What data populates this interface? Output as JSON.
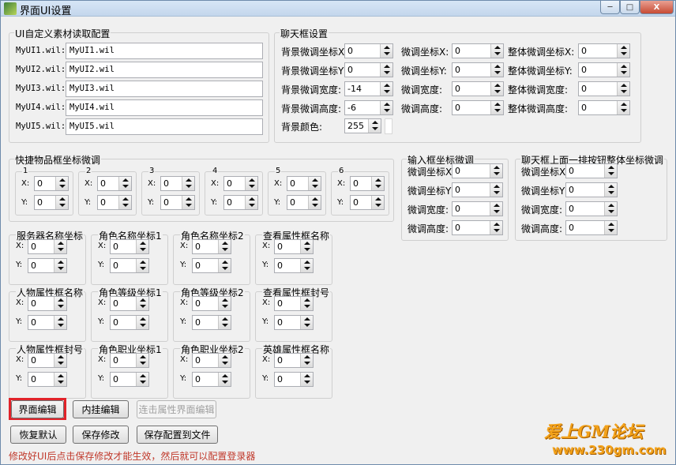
{
  "window": {
    "title": "界面UI设置",
    "controls": [
      "─",
      "□",
      "X"
    ]
  },
  "ui_group": {
    "title": "UI自定义素材读取配置",
    "rows": [
      {
        "label": "MyUI1.wil:",
        "value": "MyUI1.wil"
      },
      {
        "label": "MyUI2.wil:",
        "value": "MyUI2.wil"
      },
      {
        "label": "MyUI3.wil:",
        "value": "MyUI3.wil"
      },
      {
        "label": "MyUI4.wil:",
        "value": "MyUI4.wil"
      },
      {
        "label": "MyUI5.wil:",
        "value": "MyUI5.wil"
      }
    ]
  },
  "chat_group": {
    "title": "聊天框设置",
    "col1": [
      {
        "label": "背景微调坐标X",
        "value": "0"
      },
      {
        "label": "背景微调坐标Y",
        "value": "0"
      },
      {
        "label": "背景微调宽度:",
        "value": "-14"
      },
      {
        "label": "背景微调高度:",
        "value": "-6"
      }
    ],
    "col2": [
      {
        "label": "微调坐标X:",
        "value": "0"
      },
      {
        "label": "微调坐标Y:",
        "value": "0"
      },
      {
        "label": "微调宽度:",
        "value": "0"
      },
      {
        "label": "微调高度:",
        "value": "0"
      }
    ],
    "col3": [
      {
        "label": "整体微调坐标X:",
        "value": "0"
      },
      {
        "label": "整体微调坐标Y:",
        "value": "0"
      },
      {
        "label": "整体微调宽度:",
        "value": "0"
      },
      {
        "label": "整体微调高度:",
        "value": "0"
      }
    ],
    "bg_color_label": "背景颜色:",
    "bg_color_value": "255"
  },
  "quick_group": {
    "title": "快捷物品框坐标微调",
    "slots": [
      {
        "num": "1",
        "x": "0",
        "y": "0"
      },
      {
        "num": "2",
        "x": "0",
        "y": "0"
      },
      {
        "num": "3",
        "x": "0",
        "y": "0"
      },
      {
        "num": "4",
        "x": "0",
        "y": "0"
      },
      {
        "num": "5",
        "x": "0",
        "y": "0"
      },
      {
        "num": "6",
        "x": "0",
        "y": "0"
      }
    ],
    "x_label": "X:",
    "y_label": "Y:"
  },
  "input_group": {
    "title": "输入框坐标微调",
    "rows": [
      {
        "label": "微调坐标X",
        "value": "0"
      },
      {
        "label": "微调坐标Y",
        "value": "0"
      },
      {
        "label": "微调宽度:",
        "value": "0"
      },
      {
        "label": "微调高度:",
        "value": "0"
      }
    ]
  },
  "chatbtn_group": {
    "title": "聊天框上面一排按钮整体坐标微调",
    "rows": [
      {
        "label": "微调坐标X",
        "value": "0"
      },
      {
        "label": "微调坐标Y",
        "value": "0"
      },
      {
        "label": "微调宽度:",
        "value": "0"
      },
      {
        "label": "微调高度:",
        "value": "0"
      }
    ]
  },
  "coord_groups": [
    {
      "title": "服务器名称坐标",
      "x": "0",
      "y": "0"
    },
    {
      "title": "角色名称坐标1",
      "x": "0",
      "y": "0"
    },
    {
      "title": "角色名称坐标2",
      "x": "0",
      "y": "0"
    },
    {
      "title": "查看属性框名称",
      "x": "0",
      "y": "0"
    },
    {
      "title": "人物属性框名称",
      "x": "0",
      "y": "0"
    },
    {
      "title": "角色等级坐标1",
      "x": "0",
      "y": "0"
    },
    {
      "title": "角色等级坐标2",
      "x": "0",
      "y": "0"
    },
    {
      "title": "查看属性框封号",
      "x": "0",
      "y": "0"
    },
    {
      "title": "人物属性框封号",
      "x": "0",
      "y": "0"
    },
    {
      "title": "角色职业坐标1",
      "x": "0",
      "y": "0"
    },
    {
      "title": "角色职业坐标2",
      "x": "0",
      "y": "0"
    },
    {
      "title": "英雄属性框名称",
      "x": "0",
      "y": "0"
    }
  ],
  "buttons": {
    "ui_edit": "界面编辑",
    "plugin_edit": "内挂编辑",
    "attack_edit": "连击属性界面编辑",
    "restore": "恢复默认",
    "save": "保存修改",
    "save_file": "保存配置到文件"
  },
  "status_text": "修改好UI后点击保存修改才能生效，然后就可以配置登录器",
  "watermark": {
    "line1": "爱上GM论坛",
    "line2": "www.230gm.com"
  },
  "colors": {
    "highlight": "#e1232a",
    "status": "#c0392b",
    "watermark": "#f3a21a"
  }
}
